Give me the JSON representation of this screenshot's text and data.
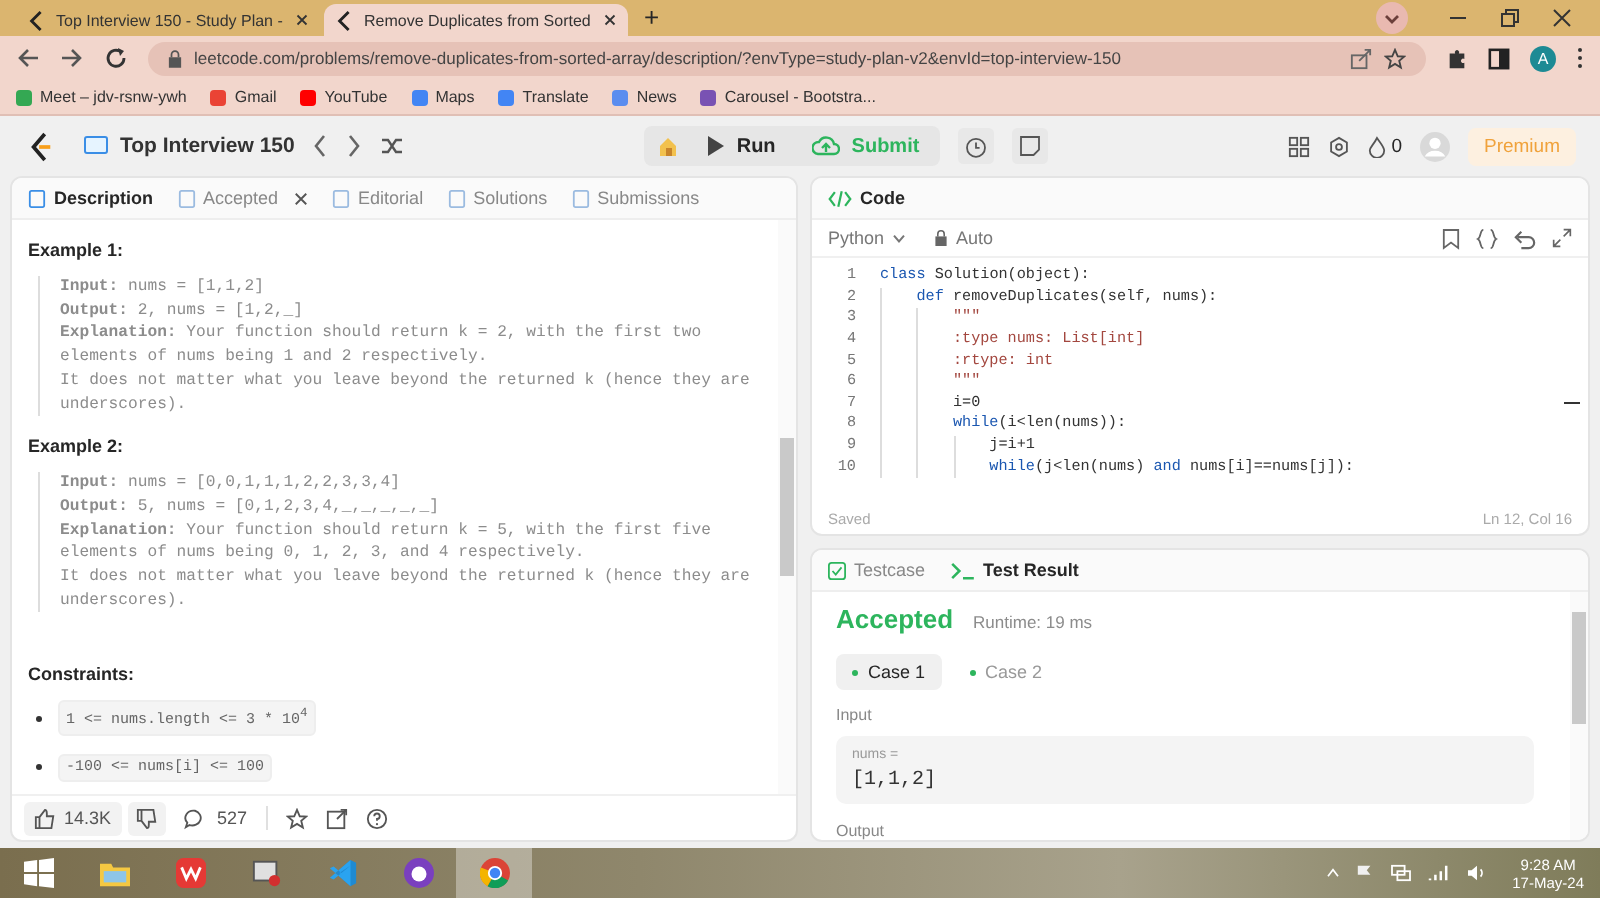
{
  "browser": {
    "tabs": [
      {
        "title": "Top Interview 150 - Study Plan -",
        "selected": false
      },
      {
        "title": "Remove Duplicates from Sorted",
        "selected": true
      }
    ],
    "new_tab": "+",
    "address": "leetcode.com/problems/remove-duplicates-from-sorted-array/description/?envType=study-plan-v2&envId=top-interview-150",
    "profile": "A",
    "bookmarks": [
      {
        "label": "Meet – jdv-rsnw-ywh",
        "color": "#34a853"
      },
      {
        "label": "Gmail",
        "color": "#ea4335"
      },
      {
        "label": "YouTube",
        "color": "#ff0000"
      },
      {
        "label": "Maps",
        "color": "#4285f4"
      },
      {
        "label": "Translate",
        "color": "#4285f4"
      },
      {
        "label": "News",
        "color": "#5b8def"
      },
      {
        "label": "Carousel - Bootstra...",
        "color": "#7952b3"
      }
    ]
  },
  "nav": {
    "list_title": "Top Interview 150",
    "run": "Run",
    "submit": "Submit",
    "streak": "0",
    "premium": "Premium"
  },
  "left": {
    "tabs": [
      {
        "label": "Description",
        "selected": true,
        "closable": false
      },
      {
        "label": "Accepted",
        "selected": false,
        "closable": true
      },
      {
        "label": "Editorial",
        "selected": false,
        "closable": false
      },
      {
        "label": "Solutions",
        "selected": false,
        "closable": false
      },
      {
        "label": "Submissions",
        "selected": false,
        "closable": false
      }
    ],
    "examples": [
      {
        "title": "Example 1:",
        "lines": [
          "**Input:** nums = [1,1,2]",
          "**Output:** 2, nums = [1,2,_]",
          "**Explanation:** Your function should return k = 2, with the first two elements of nums being 1 and 2 respectively.",
          "It does not matter what you leave beyond the returned k (hence they are underscores)."
        ]
      },
      {
        "title": "Example 2:",
        "lines": [
          "**Input:** nums = [0,0,1,1,1,2,2,3,3,4]",
          "**Output:** 5, nums = [0,1,2,3,4,_,_,_,_,_]",
          "**Explanation:** Your function should return k = 5, with the first five elements of nums being 0, 1, 2, 3, and 4 respectively.",
          "It does not matter what you leave beyond the returned k (hence they are underscores)."
        ]
      }
    ],
    "constraints_title": "Constraints:",
    "constraints": [
      "1 <= nums.length <= 3 * 10$^{4}$",
      "-100 <= nums[i] <= 100"
    ],
    "likes": "14.3K",
    "comments": "527"
  },
  "code": {
    "title": "Code",
    "language": "Python",
    "mode": "Auto",
    "lines": [
      {
        "number": "1",
        "tokens": [
          {
            "kind": "keyword",
            "text": "class"
          },
          {
            "kind": "plain",
            "text": " Solution(object):"
          }
        ]
      },
      {
        "number": "2",
        "tokens": [
          {
            "kind": "keyword",
            "text": "    def"
          },
          {
            "kind": "plain",
            "text": " removeDuplicates(self, nums):"
          }
        ]
      },
      {
        "number": "3",
        "tokens": [
          {
            "kind": "string",
            "text": "        \"\"\""
          }
        ]
      },
      {
        "number": "4",
        "tokens": [
          {
            "kind": "string",
            "text": "        :type nums: List[int]"
          }
        ]
      },
      {
        "number": "5",
        "tokens": [
          {
            "kind": "string",
            "text": "        :rtype: int"
          }
        ]
      },
      {
        "number": "6",
        "tokens": [
          {
            "kind": "string",
            "text": "        \"\"\""
          }
        ]
      },
      {
        "number": "7",
        "tokens": [
          {
            "kind": "plain",
            "text": "        i=0"
          }
        ]
      },
      {
        "number": "8",
        "tokens": [
          {
            "kind": "keyword",
            "text": "        while"
          },
          {
            "kind": "plain",
            "text": "(i<len(nums)):"
          }
        ]
      },
      {
        "number": "9",
        "tokens": [
          {
            "kind": "plain",
            "text": "            j=i+1"
          }
        ]
      },
      {
        "number": "10",
        "tokens": [
          {
            "kind": "keyword",
            "text": "            while"
          },
          {
            "kind": "plain",
            "text": "(j<len(nums) "
          },
          {
            "kind": "keyword",
            "text": "and"
          },
          {
            "kind": "plain",
            "text": " nums[i]==nums[j]):"
          }
        ]
      }
    ],
    "status": "Saved",
    "cursor": "Ln 12, Col 16"
  },
  "result": {
    "tabs": [
      {
        "label": "Testcase",
        "selected": false
      },
      {
        "label": "Test Result",
        "selected": true
      }
    ],
    "verdict": "Accepted",
    "runtime": "Runtime: 19 ms",
    "cases": [
      {
        "label": "Case 1",
        "selected": true
      },
      {
        "label": "Case 2",
        "selected": false
      }
    ],
    "input_label": "Input",
    "param": "nums =",
    "value": "[1,1,2]",
    "output_label": "Output"
  },
  "taskbar": {
    "apps": [
      {
        "kind": "start",
        "active": false
      },
      {
        "kind": "folder",
        "active": false
      },
      {
        "kind": "office",
        "active": false
      },
      {
        "kind": "media",
        "active": false
      },
      {
        "kind": "code",
        "active": false
      },
      {
        "kind": "github",
        "active": false
      },
      {
        "kind": "browser",
        "active": true
      }
    ],
    "time": "9:28 AM",
    "date": "17-May-24"
  }
}
